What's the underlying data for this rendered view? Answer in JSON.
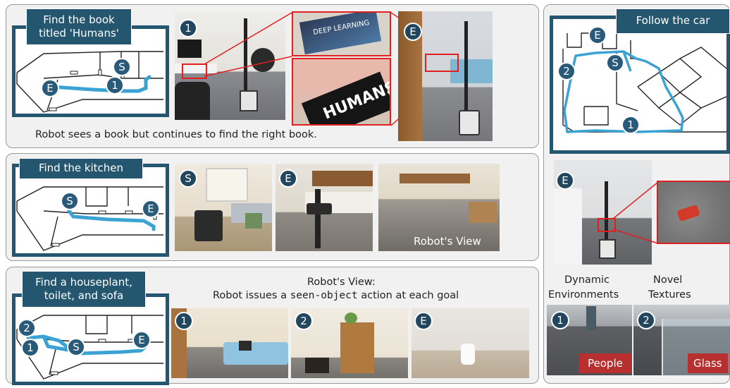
{
  "panel1": {
    "callout": "Find the book titled 'Humans'",
    "caption": "Robot sees a book but continues to find the right book.",
    "badges": {
      "map_s": "S",
      "map_1": "1",
      "map_e": "E",
      "photo_1": "1",
      "photo_e": "E"
    },
    "book_texts": {
      "deep_learning": "DEEP LEARNING",
      "humans": "HUMANS"
    }
  },
  "panel2": {
    "callout": "Find the kitchen",
    "badges": {
      "map_s": "S",
      "map_e": "E",
      "photo_s": "S",
      "photo_e": "E"
    },
    "robots_view": "Robot's View"
  },
  "panel3": {
    "callout_line1": "Find a houseplant,",
    "callout_line2": "toilet, and sofa",
    "header_line1": "Robot's View:",
    "header_pre": "Robot issues a ",
    "header_code": "seen-object",
    "header_post": " action at each goal",
    "badges": {
      "map_2": "2",
      "map_1": "1",
      "map_s": "S",
      "map_e": "E",
      "photo_1": "1",
      "photo_2": "2",
      "photo_e": "E"
    }
  },
  "panel4": {
    "callout": "Follow the car",
    "badges": {
      "map_e": "E",
      "map_s": "S",
      "map_2": "2",
      "map_1": "1",
      "photo_e": "E",
      "photo_1": "1",
      "photo_2": "2"
    },
    "label_dynamic_1": "Dynamic",
    "label_dynamic_2": "Environments",
    "label_novel_1": "Novel",
    "label_novel_2": "Textures",
    "tag_people": "People",
    "tag_glass": "Glass"
  },
  "colors": {
    "map_border": "#24566f",
    "path": "#3aa3d4",
    "badge": "#2a5a7a",
    "highlight": "#e02020",
    "tag": "#b82f2f"
  }
}
